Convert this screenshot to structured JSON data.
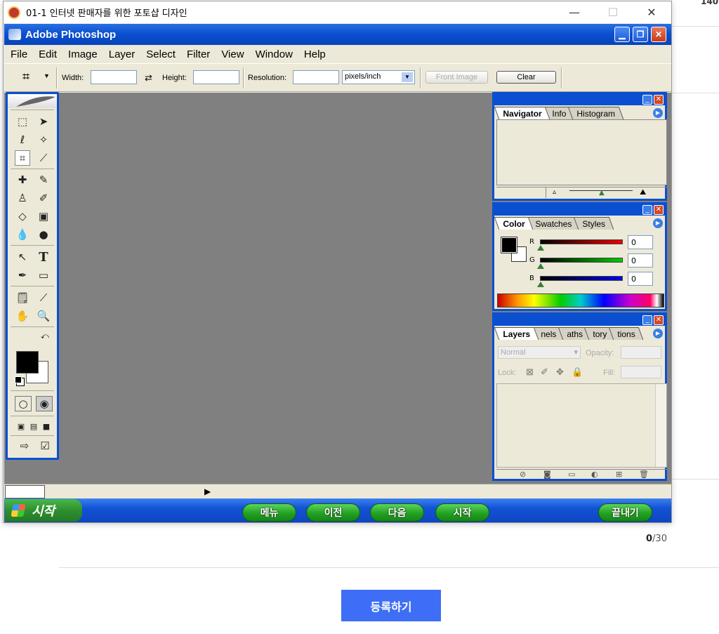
{
  "page": {
    "corner_text": "140",
    "counter_current": "0",
    "counter_total": "/30",
    "register_label": "등록하기"
  },
  "window": {
    "title": "01-1 인터넷 판매자를 위한 포토샵 디자인",
    "minimize": "—",
    "maximize": "☐",
    "close": "✕"
  },
  "photoshop": {
    "title": "Adobe Photoshop",
    "menu": [
      "File",
      "Edit",
      "Image",
      "Layer",
      "Select",
      "Filter",
      "View",
      "Window",
      "Help"
    ],
    "options": {
      "width_label": "Width:",
      "height_label": "Height:",
      "resolution_label": "Resolution:",
      "width_value": "",
      "height_value": "",
      "resolution_value": "",
      "units_selected": "pixels/inch",
      "front_image_label": "Front Image",
      "clear_label": "Clear"
    },
    "navigator": {
      "tabs": [
        "Navigator",
        "Info",
        "Histogram"
      ]
    },
    "color": {
      "tabs": [
        "Color",
        "Swatches",
        "Styles"
      ],
      "r_label": "R",
      "g_label": "G",
      "b_label": "B",
      "r_value": "0",
      "g_value": "0",
      "b_value": "0"
    },
    "layers": {
      "tabs": [
        "Layers",
        "nels",
        "aths",
        "tory",
        "tions"
      ],
      "blend_mode": "Normal",
      "opacity_label": "Opacity:",
      "lock_label": "Lock:",
      "fill_label": "Fill:"
    }
  },
  "taskbar": {
    "start_label": "시작",
    "buttons": [
      "메뉴",
      "이전",
      "다음",
      "시작"
    ],
    "exit_label": "끝내기"
  },
  "colors": {
    "xp_blue": "#0a4fd0",
    "workspace_gray": "#808080",
    "register_blue": "#3d6ef5",
    "green_button": "#21a221"
  }
}
